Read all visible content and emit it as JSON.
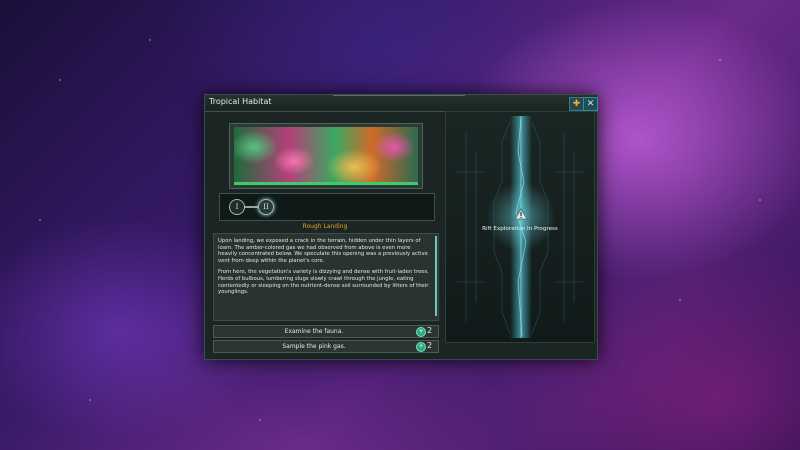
{
  "window": {
    "title": "Tropical Habitat",
    "pin_icon": "pin-icon",
    "close_icon": "close-icon",
    "close_glyph": "✕",
    "pin_glyph": "✚"
  },
  "stages": {
    "nodes": [
      "I",
      "II"
    ],
    "current": 2,
    "title": "Rough Landing"
  },
  "description": {
    "paragraphs": [
      "Upon landing, we exposed a crack in the terrain, hidden under thin layers of loam. The amber-colored gas we had observed from above is even more heavily concentrated below. We speculate this opening was a previously active vent from deep within the planet's core.",
      "From here, the vegetation's variety is dizzying and dense with fruit-laden trees. Herds of bulbous, lumbering slugs slowly crawl through the jungle, eating contentedly or sleeping on the nutrient-dense soil surrounded by litters of their younglings."
    ]
  },
  "options": [
    {
      "label": "Examine the fauna.",
      "icon": "plus-circle-icon",
      "glyph": "+",
      "count": "2"
    },
    {
      "label": "Sample the pink gas.",
      "icon": "plus-circle-icon",
      "glyph": "+",
      "count": "2"
    }
  ],
  "rift": {
    "status": "Rift Exploration In Progress",
    "icon": "warning-triangle-icon"
  },
  "colors": {
    "accent_orange": "#e8a020",
    "rift_cyan": "#6fd8e8",
    "option_green": "#2ea878"
  }
}
